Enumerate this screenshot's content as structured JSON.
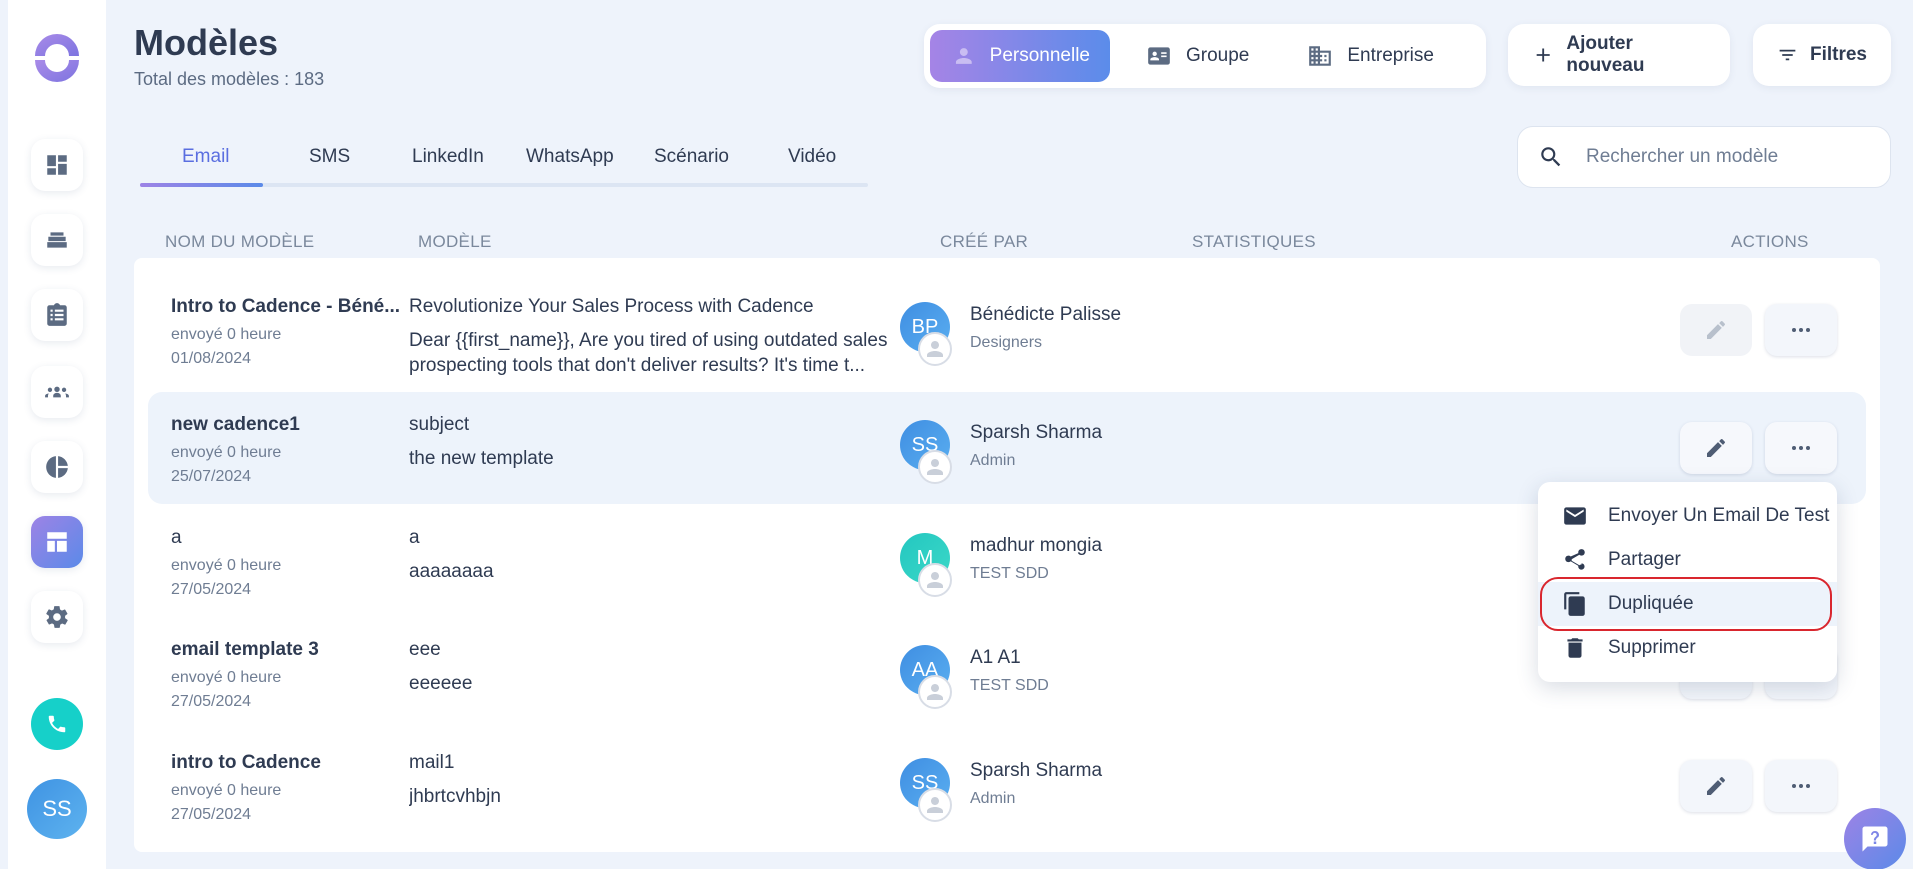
{
  "header": {
    "title": "Modèles",
    "subtitle": "Total des modèles : 183",
    "scopes": [
      "Personnelle",
      "Groupe",
      "Entreprise"
    ],
    "add_label": "Ajouter nouveau",
    "filter_label": "Filtres"
  },
  "tabs": [
    "Email",
    "SMS",
    "LinkedIn",
    "WhatsApp",
    "Scénario",
    "Vidéo"
  ],
  "search": {
    "placeholder": "Rechercher un modèle"
  },
  "columns": [
    "NOM DU MODÈLE",
    "MODÈLE",
    "CRÉÉ PAR",
    "STATISTIQUES",
    "ACTIONS"
  ],
  "rows": [
    {
      "name": "Intro to Cadence - Béné...",
      "sent": "envoyé 0 heure",
      "date": "01/08/2024",
      "subject": "Revolutionize Your Sales Process with Cadence",
      "body": "Dear {{first_name}},   Are you tired of using outdated sales prospecting tools that don't deliver results? It's time t...",
      "initials": "BP",
      "creator": "Bénédicte Palisse",
      "role": "Designers"
    },
    {
      "name": "new cadence1",
      "sent": "envoyé 0 heure",
      "date": "25/07/2024",
      "subject": "subject",
      "body": "the new template",
      "initials": "SS",
      "creator": "Sparsh Sharma",
      "role": "Admin"
    },
    {
      "name": "a",
      "sent": "envoyé 0 heure",
      "date": "27/05/2024",
      "subject": "a",
      "body": "aaaaaaaa",
      "initials": "M",
      "creator": "madhur mongia",
      "role": "TEST SDD"
    },
    {
      "name": "email template 3",
      "sent": "envoyé 0 heure",
      "date": "27/05/2024",
      "subject": "eee",
      "body": "eeeeee",
      "initials": "AA",
      "creator": "A1 A1",
      "role": "TEST SDD"
    },
    {
      "name": "intro to Cadence",
      "sent": "envoyé 0 heure",
      "date": "27/05/2024",
      "subject": "mail1",
      "body": "jhbrtcvhbjn",
      "initials": "SS",
      "creator": "Sparsh Sharma",
      "role": "Admin"
    }
  ],
  "menu": [
    "Envoyer Un Email De Test",
    "Partager",
    "Dupliquée",
    "Supprimer"
  ],
  "user": {
    "initials": "SS"
  },
  "colors": {
    "accent_from": "#9d83e6",
    "accent_to": "#5b8ae8",
    "teal": "#16d0c9",
    "highlight": "#d9262e"
  }
}
